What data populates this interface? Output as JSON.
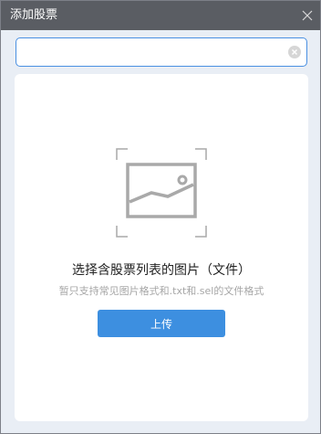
{
  "window": {
    "title": "添加股票",
    "close_icon": "close-icon"
  },
  "search": {
    "value": "",
    "placeholder": "",
    "clear_icon": "clear-circle-icon",
    "border_color": "#4a90e2"
  },
  "drop_zone": {
    "icon": "image-placeholder-icon",
    "title": "选择含股票列表的图片（文件）",
    "hint": "暂只支持常见图片格式和.txt和.sel的文件格式",
    "upload_label": "上传"
  },
  "colors": {
    "titlebar": "#5a5d63",
    "accent": "#3d8fe0",
    "background": "#e9eef5"
  }
}
